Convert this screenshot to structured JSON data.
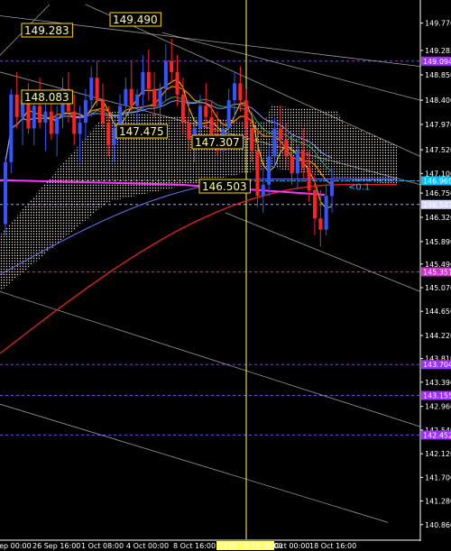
{
  "chart_data": {
    "type": "candlestick",
    "ylim": [
      140.6,
      150.1
    ],
    "price_ticks": [
      "149.770",
      "149.285",
      "148.850",
      "148.400",
      "147.970",
      "147.520",
      "147.100",
      "146.750",
      "146.320",
      "145.890",
      "145.490",
      "145.070",
      "144.650",
      "144.220",
      "143.810",
      "143.390",
      "142.960",
      "142.540",
      "142.120",
      "141.700",
      "141.280",
      "140.860"
    ],
    "price_tick_values": [
      149.77,
      149.285,
      148.85,
      148.4,
      147.97,
      147.52,
      147.1,
      146.75,
      146.32,
      145.89,
      145.49,
      145.07,
      144.65,
      144.22,
      143.81,
      143.39,
      142.96,
      142.54,
      142.12,
      141.7,
      141.28,
      140.86
    ],
    "date_labels": [
      "Sep 00:00",
      "26 Sep 16:00",
      "1 Oct 08:00",
      "4 Oct 00:00",
      "8 Oct 16:00",
      "2018.10.15 00:00",
      "Oct 00:00",
      "18 Oct 16:00"
    ],
    "highlight_date": "2018.10.15 00:00",
    "price_boxes": [
      {
        "label": "149.094",
        "value": 149.094,
        "color": "#9b30ff"
      },
      {
        "label": "146.969",
        "value": 146.969,
        "color": "#00bfff"
      },
      {
        "label": "146.547",
        "value": 146.547,
        "color": "#d8d8ff"
      },
      {
        "label": "145.351",
        "value": 145.351,
        "color": "#cc33cc"
      },
      {
        "label": "143.704",
        "value": 143.704,
        "color": "#9b30ff"
      },
      {
        "label": "143.155",
        "value": 143.155,
        "color": "#9b30ff"
      },
      {
        "label": "142.452",
        "value": 142.452,
        "color": "#9b30ff"
      }
    ],
    "annotations": [
      {
        "label": "149.490",
        "value": 149.49
      },
      {
        "label": "149.283",
        "value": 149.283
      },
      {
        "label": "148.083",
        "value": 148.083
      },
      {
        "label": "147.475",
        "value": 147.475
      },
      {
        "label": "147.307",
        "value": 147.307
      },
      {
        "label": "146.503",
        "value": 146.503
      }
    ],
    "marker_text": "<0.1",
    "colors": {
      "bull": "#3355ff",
      "bear": "#ff2222",
      "fast_ma": "#ffd700",
      "ma200": "#dd2222",
      "magenta_ma": "#ff33ff",
      "cloud": "#eee2d8",
      "grid_dash": "#8844cc",
      "vline": "#ffff66",
      "fib": "#ffffff",
      "cyan": "#00bfff"
    },
    "candles": [
      {
        "o": 146.2,
        "h": 147.4,
        "l": 146.0,
        "c": 147.3
      },
      {
        "o": 147.3,
        "h": 148.6,
        "l": 147.1,
        "c": 148.5
      },
      {
        "o": 148.5,
        "h": 148.9,
        "l": 147.9,
        "c": 148.1
      },
      {
        "o": 148.1,
        "h": 148.6,
        "l": 147.6,
        "c": 148.4
      },
      {
        "o": 148.4,
        "h": 148.7,
        "l": 147.8,
        "c": 147.9
      },
      {
        "o": 147.9,
        "h": 148.5,
        "l": 147.6,
        "c": 148.3
      },
      {
        "o": 148.3,
        "h": 148.8,
        "l": 147.9,
        "c": 148.0
      },
      {
        "o": 148.0,
        "h": 148.4,
        "l": 147.5,
        "c": 148.2
      },
      {
        "o": 148.2,
        "h": 148.5,
        "l": 147.7,
        "c": 147.8
      },
      {
        "o": 147.8,
        "h": 148.3,
        "l": 147.4,
        "c": 148.1
      },
      {
        "o": 148.1,
        "h": 148.8,
        "l": 147.9,
        "c": 148.6
      },
      {
        "o": 148.6,
        "h": 148.9,
        "l": 148.0,
        "c": 148.2
      },
      {
        "o": 148.2,
        "h": 148.5,
        "l": 147.6,
        "c": 147.8
      },
      {
        "o": 147.8,
        "h": 148.3,
        "l": 147.3,
        "c": 148.0
      },
      {
        "o": 148.0,
        "h": 148.6,
        "l": 147.7,
        "c": 148.4
      },
      {
        "o": 148.4,
        "h": 149.0,
        "l": 148.1,
        "c": 148.8
      },
      {
        "o": 148.8,
        "h": 149.1,
        "l": 148.3,
        "c": 148.4
      },
      {
        "o": 148.4,
        "h": 148.7,
        "l": 147.9,
        "c": 148.0
      },
      {
        "o": 148.0,
        "h": 148.3,
        "l": 147.4,
        "c": 147.6
      },
      {
        "o": 147.6,
        "h": 148.0,
        "l": 147.3,
        "c": 147.9
      },
      {
        "o": 147.9,
        "h": 148.5,
        "l": 147.7,
        "c": 148.3
      },
      {
        "o": 148.3,
        "h": 148.8,
        "l": 148.0,
        "c": 148.6
      },
      {
        "o": 148.6,
        "h": 149.1,
        "l": 148.2,
        "c": 148.3
      },
      {
        "o": 148.3,
        "h": 148.6,
        "l": 147.9,
        "c": 148.5
      },
      {
        "o": 148.5,
        "h": 149.2,
        "l": 148.2,
        "c": 148.9
      },
      {
        "o": 148.9,
        "h": 149.3,
        "l": 148.4,
        "c": 148.6
      },
      {
        "o": 148.6,
        "h": 148.9,
        "l": 148.1,
        "c": 148.3
      },
      {
        "o": 148.3,
        "h": 148.7,
        "l": 147.9,
        "c": 148.6
      },
      {
        "o": 148.6,
        "h": 149.4,
        "l": 148.4,
        "c": 149.1
      },
      {
        "o": 149.1,
        "h": 149.49,
        "l": 148.7,
        "c": 148.9
      },
      {
        "o": 148.9,
        "h": 149.2,
        "l": 148.3,
        "c": 148.5
      },
      {
        "o": 148.5,
        "h": 148.8,
        "l": 147.8,
        "c": 148.0
      },
      {
        "o": 148.0,
        "h": 148.4,
        "l": 147.5,
        "c": 147.7
      },
      {
        "o": 147.7,
        "h": 148.1,
        "l": 147.3,
        "c": 147.9
      },
      {
        "o": 147.9,
        "h": 148.5,
        "l": 147.7,
        "c": 148.3
      },
      {
        "o": 148.3,
        "h": 148.7,
        "l": 147.9,
        "c": 148.1
      },
      {
        "o": 148.1,
        "h": 148.4,
        "l": 147.6,
        "c": 147.8
      },
      {
        "o": 147.8,
        "h": 148.2,
        "l": 147.4,
        "c": 147.5
      },
      {
        "o": 147.5,
        "h": 148.0,
        "l": 147.3,
        "c": 147.9
      },
      {
        "o": 147.9,
        "h": 148.6,
        "l": 147.7,
        "c": 148.4
      },
      {
        "o": 148.4,
        "h": 148.9,
        "l": 148.1,
        "c": 148.7
      },
      {
        "o": 148.7,
        "h": 149.0,
        "l": 148.2,
        "c": 148.4
      },
      {
        "o": 148.4,
        "h": 148.6,
        "l": 147.7,
        "c": 147.9
      },
      {
        "o": 147.9,
        "h": 148.2,
        "l": 147.3,
        "c": 147.5
      },
      {
        "o": 147.5,
        "h": 147.9,
        "l": 146.5,
        "c": 146.7
      },
      {
        "o": 146.7,
        "h": 147.2,
        "l": 146.4,
        "c": 146.9
      },
      {
        "o": 146.9,
        "h": 147.6,
        "l": 146.7,
        "c": 147.4
      },
      {
        "o": 147.4,
        "h": 148.1,
        "l": 147.2,
        "c": 147.9
      },
      {
        "o": 147.9,
        "h": 148.3,
        "l": 147.5,
        "c": 147.7
      },
      {
        "o": 147.7,
        "h": 148.0,
        "l": 147.2,
        "c": 147.4
      },
      {
        "o": 147.4,
        "h": 147.8,
        "l": 146.9,
        "c": 147.1
      },
      {
        "o": 147.1,
        "h": 147.6,
        "l": 146.8,
        "c": 147.5
      },
      {
        "o": 147.5,
        "h": 147.9,
        "l": 147.0,
        "c": 147.2
      },
      {
        "o": 147.2,
        "h": 147.5,
        "l": 146.6,
        "c": 146.8
      },
      {
        "o": 146.8,
        "h": 147.1,
        "l": 146.0,
        "c": 146.3
      },
      {
        "o": 146.3,
        "h": 146.8,
        "l": 145.8,
        "c": 146.1
      },
      {
        "o": 146.1,
        "h": 146.9,
        "l": 146.0,
        "c": 146.7
      },
      {
        "o": 146.7,
        "h": 147.2,
        "l": 146.4,
        "c": 146.97
      }
    ]
  }
}
